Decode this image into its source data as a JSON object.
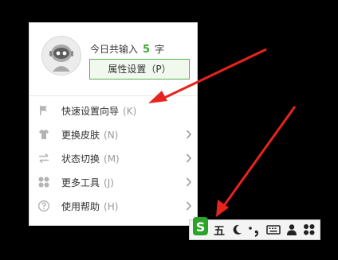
{
  "menu": {
    "count_prefix": "今日共输入",
    "count_value": "5",
    "count_suffix": "字",
    "settings_button": "属性设置（P）",
    "items": [
      {
        "label": "快速设置向导",
        "key": "(K)",
        "icon": "flag-icon",
        "has_submenu": false
      },
      {
        "label": "更换皮肤",
        "key": "(N)",
        "icon": "shirt-icon",
        "has_submenu": true
      },
      {
        "label": "状态切换",
        "key": "(M)",
        "icon": "switch-arrows-icon",
        "has_submenu": true
      },
      {
        "label": "更多工具",
        "key": "(J)",
        "icon": "tools-icon",
        "has_submenu": true
      },
      {
        "label": "使用帮助",
        "key": "(H)",
        "icon": "help-icon",
        "has_submenu": true
      }
    ]
  },
  "taskbar": {
    "logo": "S",
    "mode_label": "五",
    "icons": [
      "sogou-logo-icon",
      "wubi-mode",
      "moon-icon",
      "punctuation-icon",
      "keyboard-icon",
      "user-icon",
      "grid-icon"
    ]
  },
  "colors": {
    "accent_green": "#3ca834",
    "annotation_red": "#e8231e"
  }
}
